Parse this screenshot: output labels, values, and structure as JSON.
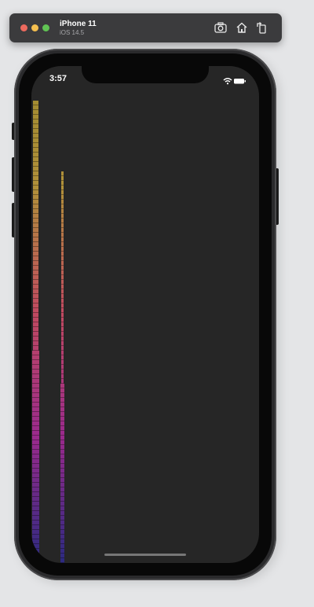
{
  "window": {
    "device_name": "iPhone 11",
    "os_version": "iOS 14.5",
    "traffic_lights": [
      "close",
      "minimize",
      "zoom"
    ],
    "toolbar": [
      {
        "icon": "screenshot-icon"
      },
      {
        "icon": "home-icon"
      },
      {
        "icon": "rotate-icon"
      }
    ]
  },
  "status_bar": {
    "time": "3:57",
    "icons": [
      "wifi-icon",
      "battery-icon"
    ]
  },
  "content": {
    "background": "#262626",
    "columns": [
      {
        "name": "left-column",
        "level": 0.93
      },
      {
        "name": "right-column",
        "level": 0.79
      }
    ],
    "gradient_colors": [
      "#2e2a80",
      "#9a2a8c",
      "#c04a60",
      "#b0903a",
      "#9e8a2e"
    ]
  }
}
